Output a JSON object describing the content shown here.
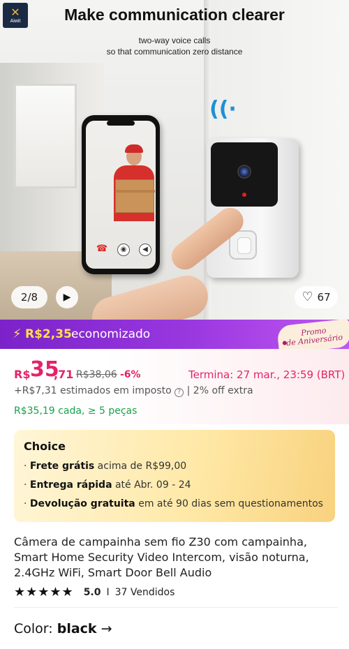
{
  "hero": {
    "logo_brand": "Aiwit",
    "title": "Make communication clearer",
    "subtitle_line1": "two-way voice calls",
    "subtitle_line2": "so that communication zero distance",
    "counter": "2/8",
    "likes": "67"
  },
  "promo": {
    "amount": "R$2,35",
    "saved_label": "economizado",
    "badge_line1": "Promo",
    "badge_line2": "de Aniversário"
  },
  "price": {
    "currency": "R$",
    "integer": "35",
    "cents": ",71",
    "original": "R$38,06",
    "discount": "-6%",
    "ends": "Termina:  27 mar., 23:59 (BRT)",
    "tax_prefix": "+R$7,31 estimados em imposto",
    "tax_suffix": " | 2% off extra",
    "bulk": "R$35,19 cada, ≥ 5 peças"
  },
  "choice": {
    "title": "Choice",
    "rows": [
      {
        "bold": "Frete grátis",
        "rest": " acima de R$99,00"
      },
      {
        "bold": "Entrega rápida",
        "rest": " até Abr. 09 - 24"
      },
      {
        "bold": "Devolução gratuita",
        "rest": "  em até 90 dias sem questionamentos"
      }
    ]
  },
  "product": {
    "title": "Câmera de campainha sem fio Z30 com campainha, Smart Home Security Video Intercom, visão noturna, 2.4GHz WiFi, Smart Door Bell Audio",
    "rating": "5.0",
    "rating_value": 5,
    "sold": "37 Vendidos"
  },
  "variant": {
    "label": "Color: ",
    "value": "black"
  },
  "colors": {
    "accent": "#e3236a",
    "promo_purple": "#8a2be2",
    "bulk_green": "#16a34a"
  },
  "icons": [
    "play-icon",
    "heart-icon",
    "bolt-icon",
    "question-icon",
    "star-icon",
    "arrow-right-icon"
  ]
}
